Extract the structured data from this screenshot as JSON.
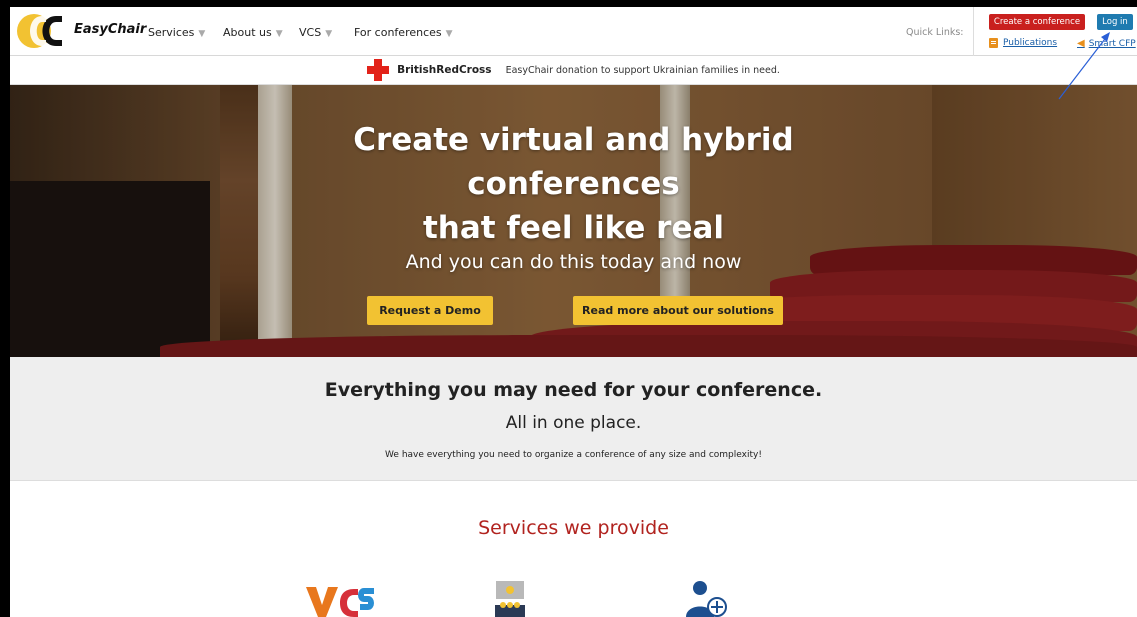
{
  "nav": {
    "logo_text": "EasyChair",
    "items": [
      {
        "label": "Services",
        "caret": "▼"
      },
      {
        "label": "About us",
        "caret": "▼"
      },
      {
        "label": "VCS",
        "caret": "▼"
      },
      {
        "label": "For conferences",
        "caret": "▼"
      }
    ],
    "quick_links_label": "Quick Links:",
    "create_conference": "Create a conference",
    "login": "Log in",
    "publications": "Publications",
    "smart_cfp": "Smart CFP"
  },
  "banner": {
    "org": "BritishRedCross",
    "message": "EasyChair donation to support Ukrainian families in need."
  },
  "hero": {
    "title_line1": "Create virtual and hybrid",
    "title_line2": "conferences",
    "title_line3": "that feel like real",
    "subtitle": "And you can do this today and now",
    "demo_button": "Request a Demo",
    "solutions_button": "Read more about our solutions"
  },
  "everything": {
    "title": "Everything you may need for your conference.",
    "subtitle": "All in one place.",
    "description": "We have everything you need to organize a conference of any size and complexity!"
  },
  "services": {
    "title": "Services we provide",
    "icons": [
      "vcs-logo-icon",
      "audience-screen-icon",
      "add-user-icon"
    ]
  },
  "colors": {
    "create_button": "#c9201e",
    "login_button": "#1f7bb0",
    "hero_button": "#f2c232",
    "services_title": "#b1231f",
    "annotation_arrow": "#2a5fd6"
  }
}
